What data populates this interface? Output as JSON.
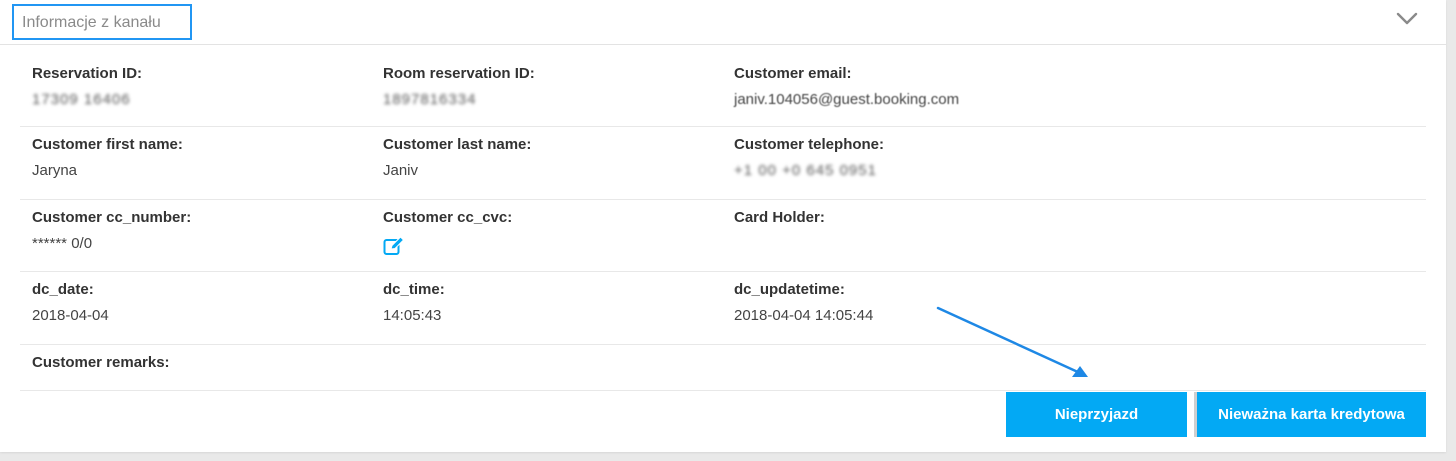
{
  "panel": {
    "title": "Informacje z kanału",
    "collapse_icon": "chevron-down-icon"
  },
  "rows": [
    [
      {
        "label": "Reservation ID:",
        "value": "17309 16406",
        "redacted": true
      },
      {
        "label": "Room reservation ID:",
        "value": "1897816334",
        "redacted": true
      },
      {
        "label": "Customer email:",
        "value": "janiv.104056@guest.booking.com",
        "redacted": true
      }
    ],
    [
      {
        "label": "Customer first name:",
        "value": "Jaryna"
      },
      {
        "label": "Customer last name:",
        "value": "Janiv"
      },
      {
        "label": "Customer telephone:",
        "value": "+1 00 +0 645 0951",
        "redacted": true
      }
    ],
    [
      {
        "label": "Customer cc_number:",
        "value": "****** 0/0"
      },
      {
        "label": "Customer cc_cvc:",
        "value": "",
        "icon": "edit-icon"
      },
      {
        "label": "Card Holder:",
        "value": ""
      }
    ],
    [
      {
        "label": "dc_date:",
        "value": "2018-04-04"
      },
      {
        "label": "dc_time:",
        "value": "14:05:43"
      },
      {
        "label": "dc_updatetime:",
        "value": "2018-04-04 14:05:44"
      }
    ],
    [
      {
        "label": "Customer remarks:",
        "value": ""
      }
    ]
  ],
  "buttons": {
    "no_show": "Nieprzyjazd",
    "invalid_card": "Nieważna karta kredytowa"
  },
  "colors": {
    "accent": "#03a9f4",
    "highlight": "#2196f3",
    "annotation_arrow": "#1e88e5"
  }
}
